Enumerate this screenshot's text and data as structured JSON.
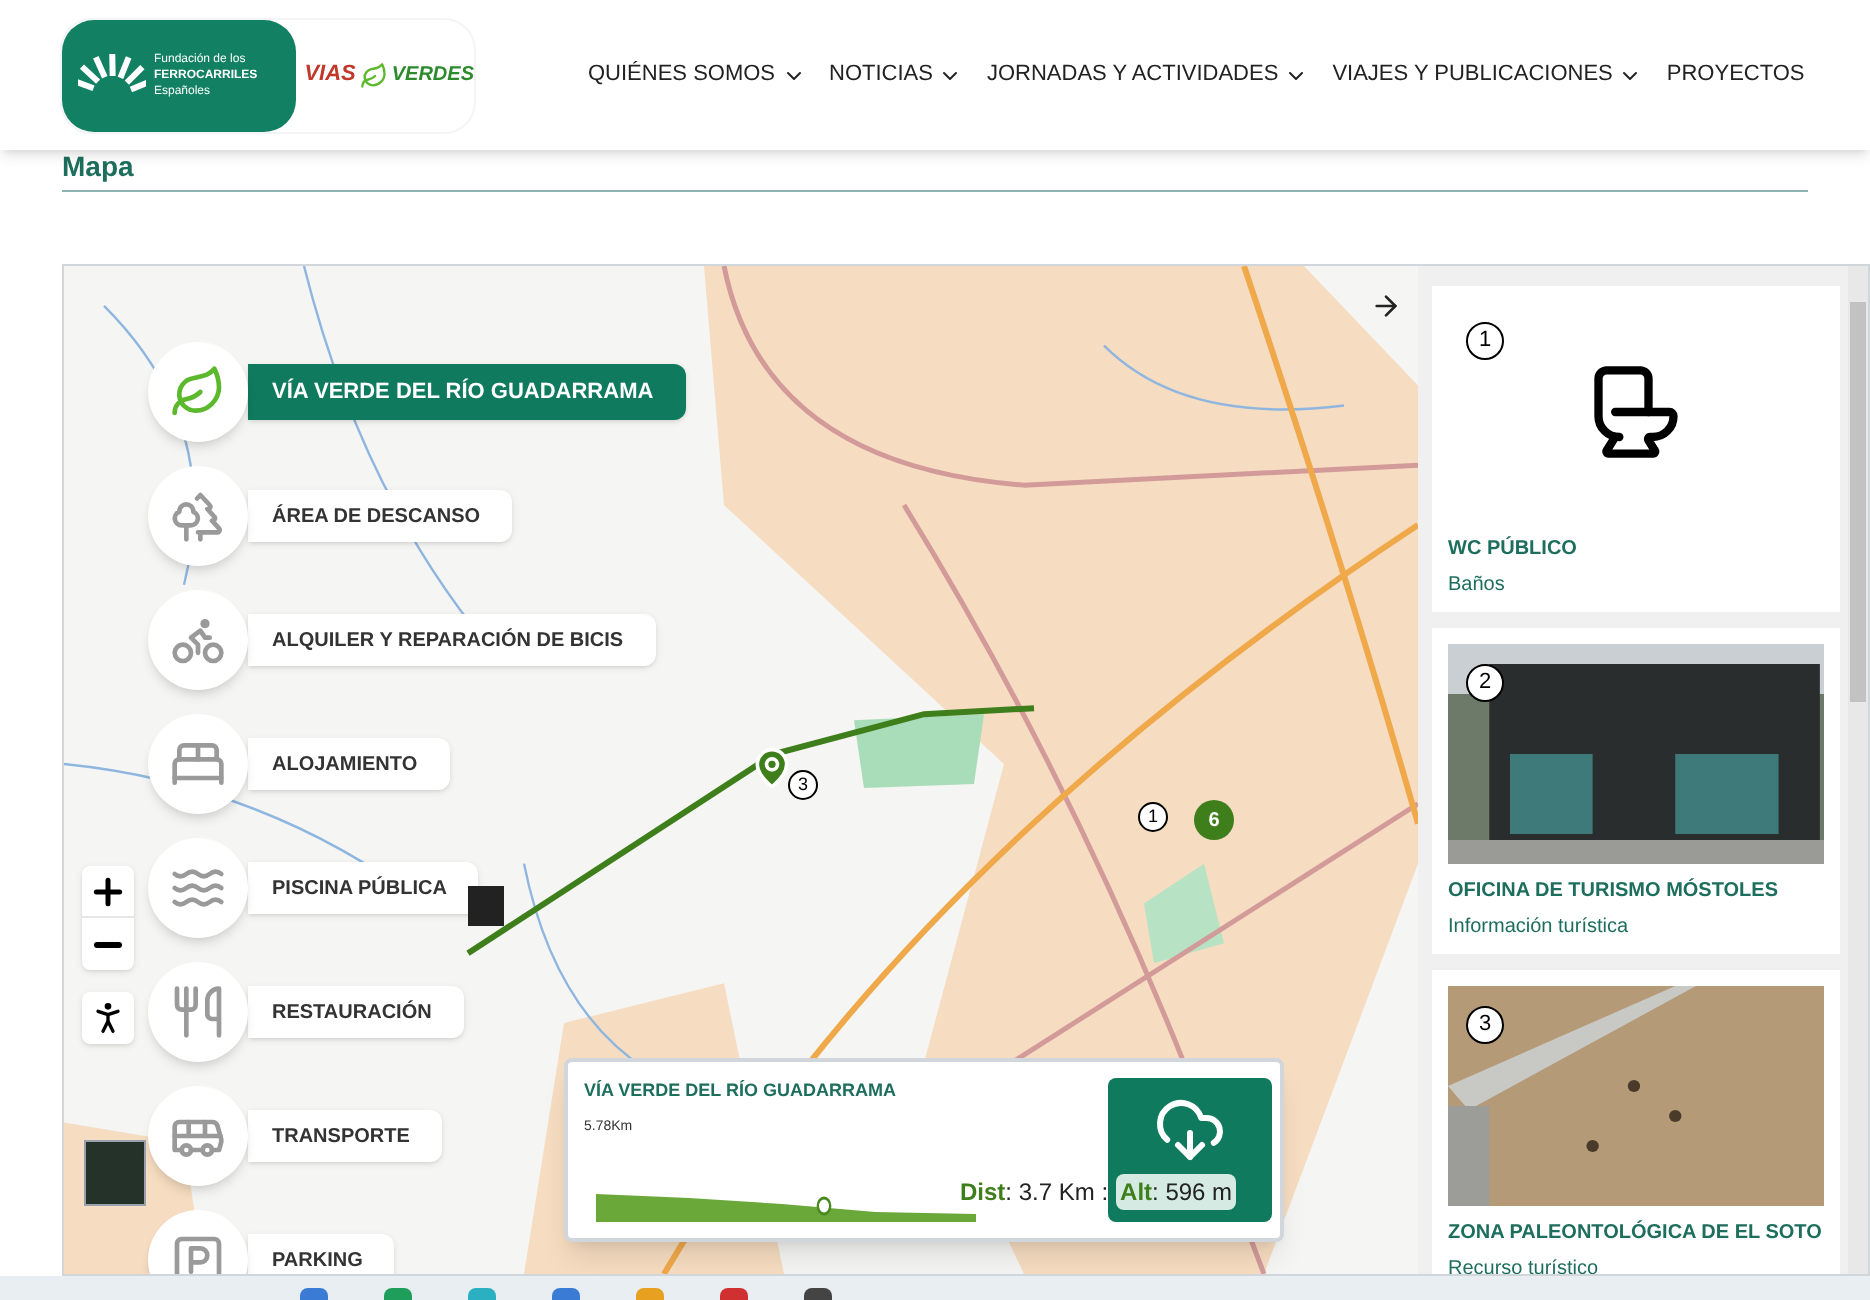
{
  "logo": {
    "foundation_lines": [
      "Fundación de los",
      "FERROCARRILES",
      "Españoles"
    ],
    "brand_words": [
      "VIAS",
      "VERDES"
    ]
  },
  "nav": [
    {
      "label": "QUIÉNES SOMOS",
      "has_dropdown": true
    },
    {
      "label": "NOTICIAS",
      "has_dropdown": true
    },
    {
      "label": "JORNADAS Y ACTIVIDADES",
      "has_dropdown": true
    },
    {
      "label": "VIAJES Y PUBLICACIONES",
      "has_dropdown": true
    },
    {
      "label": "PROYECTOS",
      "has_dropdown": false
    }
  ],
  "page_title": "Mapa",
  "map": {
    "categories": [
      {
        "kind": "trail",
        "label": "VÍA VERDE DEL RÍO GUADARRAMA",
        "selected": true
      },
      {
        "kind": "rest",
        "label": "ÁREA DE DESCANSO",
        "selected": false
      },
      {
        "kind": "bike",
        "label": "ALQUILER Y REPARACIÓN DE BICIS",
        "selected": false
      },
      {
        "kind": "lodging",
        "label": "ALOJAMIENTO",
        "selected": false
      },
      {
        "kind": "pool",
        "label": "PISCINA PÚBLICA",
        "selected": false
      },
      {
        "kind": "food",
        "label": "RESTAURACIÓN",
        "selected": false
      },
      {
        "kind": "transport",
        "label": "TRANSPORTE",
        "selected": false
      },
      {
        "kind": "parking",
        "label": "PARKING",
        "selected": false
      }
    ],
    "markers": [
      {
        "kind": "numbered",
        "label": "3"
      },
      {
        "kind": "numbered",
        "label": "1"
      },
      {
        "kind": "cluster",
        "label": "6"
      }
    ],
    "elevation": {
      "title": "VÍA VERDE DEL RÍO GUADARRAMA",
      "length": "5.78Km",
      "dist_label": "Dist",
      "dist_value": ": 3.7 Km :",
      "alt_label": "Alt",
      "alt_value": ": 596 m",
      "level": 0.6
    }
  },
  "points": [
    {
      "number": "1",
      "kind": "icon",
      "title": "WC PÚBLICO",
      "subtitle": "Baños"
    },
    {
      "number": "2",
      "kind": "picture",
      "title": "OFICINA DE TURISMO MÓSTOLES",
      "subtitle": "Información turística"
    },
    {
      "number": "3",
      "kind": "picture",
      "title": "ZONA PALEONTOLÓGICA DE EL SOTO",
      "subtitle": "Recurso turístico"
    }
  ]
}
